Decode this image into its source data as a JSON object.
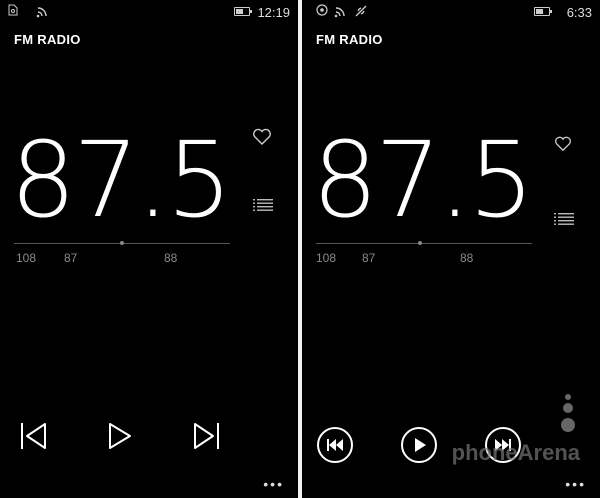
{
  "left": {
    "status": {
      "time": "12:19"
    },
    "title": "FM RADIO",
    "frequency": "87.5",
    "ticks": [
      "108",
      "87",
      "88"
    ]
  },
  "right": {
    "status": {
      "time": "6:33"
    },
    "title": "FM RADIO",
    "frequency": "87.5",
    "ticks": [
      "108",
      "87",
      "88"
    ]
  },
  "more_label": "•••",
  "watermark": "phoneArena",
  "icons": [
    "sim-icon",
    "signal-icon",
    "battery-icon",
    "heart-icon",
    "list-icon",
    "previous-icon",
    "play-icon",
    "next-icon",
    "more-icon"
  ]
}
